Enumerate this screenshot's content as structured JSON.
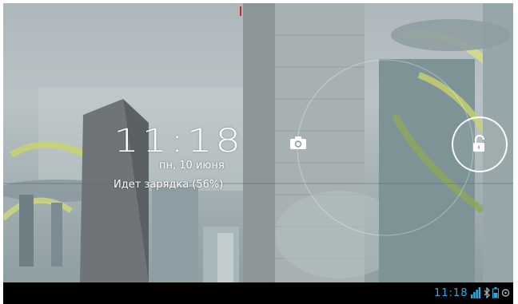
{
  "lockscreen": {
    "time": "11:18",
    "date": "пн, 10 июня",
    "charging_status": "Идет зарядка (56%)"
  },
  "status_bar": {
    "time": "11:18",
    "icons": [
      "signal-icon",
      "bluetooth-icon",
      "battery-icon",
      "wifi-icon"
    ]
  },
  "colors": {
    "status_accent": "#2ea9de",
    "wallpaper_tint": "#a8b4b7"
  }
}
